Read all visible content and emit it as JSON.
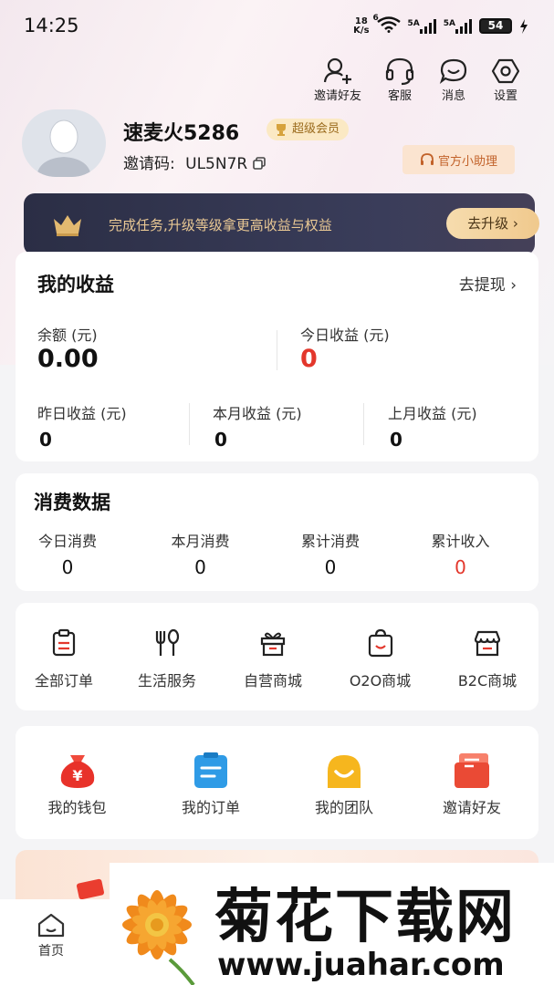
{
  "status_bar": {
    "time": "14:25",
    "net_speed_top": "18",
    "net_speed_unit": "K/s",
    "sim1": "5A",
    "sim2": "5A",
    "wifi_label": "6",
    "battery": "54"
  },
  "top_actions": [
    {
      "label": "邀请好友",
      "icon": "invite-friend-icon"
    },
    {
      "label": "客服",
      "icon": "headset-icon"
    },
    {
      "label": "消息",
      "icon": "message-icon"
    },
    {
      "label": "设置",
      "icon": "settings-icon"
    }
  ],
  "profile": {
    "name": "速麦火5286",
    "badge": "超级会员",
    "invite_label": "邀请码:",
    "invite_code": "UL5N7R",
    "helper_button": "官方小助理"
  },
  "banner": {
    "text": "完成任务,升级等级拿更高收益与权益",
    "button": "去升级"
  },
  "earnings": {
    "title": "我的收益",
    "withdraw": "去提现",
    "balance_label": "余额 (元)",
    "balance_value": "0.00",
    "today_label": "今日收益 (元)",
    "today_value": "0",
    "yesterday_label": "昨日收益 (元)",
    "yesterday_value": "0",
    "month_label": "本月收益 (元)",
    "month_value": "0",
    "last_month_label": "上月收益 (元)",
    "last_month_value": "0"
  },
  "consumption": {
    "title": "消费数据",
    "items": [
      {
        "label": "今日消费",
        "value": "0"
      },
      {
        "label": "本月消费",
        "value": "0"
      },
      {
        "label": "累计消费",
        "value": "0"
      },
      {
        "label": "累计收入",
        "value": "0"
      }
    ]
  },
  "orders": [
    {
      "label": "全部订单",
      "icon": "clipboard-icon"
    },
    {
      "label": "生活服务",
      "icon": "fork-spoon-icon"
    },
    {
      "label": "自营商城",
      "icon": "gift-box-icon"
    },
    {
      "label": "O2O商城",
      "icon": "shopping-bag-icon"
    },
    {
      "label": "B2C商城",
      "icon": "store-icon"
    }
  ],
  "shortcuts": [
    {
      "label": "我的钱包",
      "icon": "wallet-bag-icon",
      "glyph": "¥"
    },
    {
      "label": "我的订单",
      "icon": "order-clipboard-icon"
    },
    {
      "label": "我的团队",
      "icon": "team-smile-icon"
    },
    {
      "label": "邀请好友",
      "icon": "invite-card-icon"
    }
  ],
  "bottom_nav": {
    "home": "首页"
  },
  "watermark": {
    "title": "菊花下载网",
    "url": "www.juahar.com"
  },
  "colors": {
    "accent_red": "#e3372c",
    "gold": "#e9c894",
    "banner_bg": "#2b2e45"
  }
}
